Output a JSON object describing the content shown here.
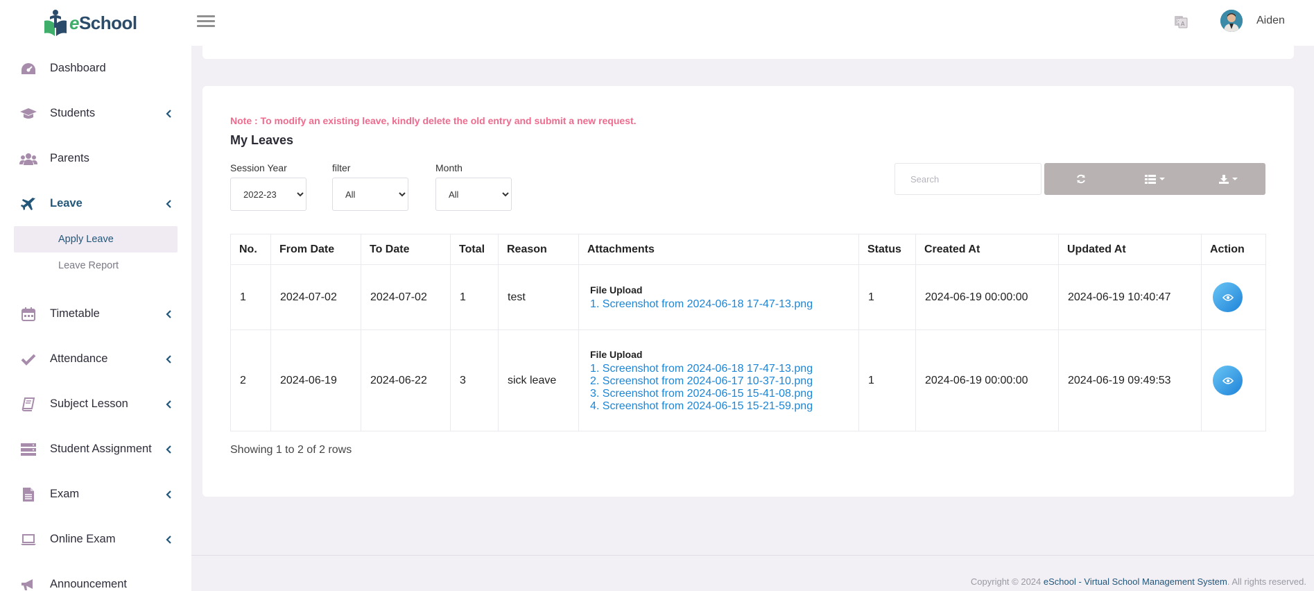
{
  "brand": {
    "name_prefix": "e",
    "name_rest": "School"
  },
  "sidebar": {
    "items": [
      {
        "label": "Dashboard",
        "icon": "dashboard-icon"
      },
      {
        "label": "Students",
        "icon": "graduation-cap-icon"
      },
      {
        "label": "Parents",
        "icon": "users-icon"
      },
      {
        "label": "Leave",
        "icon": "plane-icon"
      },
      {
        "label": "Timetable",
        "icon": "calendar-icon"
      },
      {
        "label": "Attendance",
        "icon": "check-icon"
      },
      {
        "label": "Subject Lesson",
        "icon": "book-icon"
      },
      {
        "label": "Student Assignment",
        "icon": "server-icon"
      },
      {
        "label": "Exam",
        "icon": "file-icon"
      },
      {
        "label": "Online Exam",
        "icon": "laptop-icon"
      },
      {
        "label": "Announcement",
        "icon": "bullhorn-icon"
      }
    ],
    "leave_sub": [
      {
        "label": "Apply Leave"
      },
      {
        "label": "Leave Report"
      }
    ]
  },
  "topbar": {
    "username": "Aiden"
  },
  "card": {
    "note": "Note : To modify an existing leave, kindly delete the old entry and submit a new request.",
    "title": "My Leaves",
    "filters": {
      "session_label": "Session Year",
      "session_value": "2022-23",
      "filter_label": "filter",
      "filter_value": "All",
      "month_label": "Month",
      "month_value": "All"
    },
    "search_placeholder": "Search"
  },
  "table": {
    "headers": [
      "No.",
      "From Date",
      "To Date",
      "Total",
      "Reason",
      "Attachments",
      "Status",
      "Created At",
      "Updated At",
      "Action"
    ],
    "rows": [
      {
        "no": "1",
        "from": "2024-07-02",
        "to": "2024-07-02",
        "total": "1",
        "reason": "test",
        "att_title": "File Upload",
        "attachments": [
          "1. Screenshot from 2024-06-18 17-47-13.png"
        ],
        "status": "1",
        "created": "2024-06-19 00:00:00",
        "updated": "2024-06-19 10:40:47"
      },
      {
        "no": "2",
        "from": "2024-06-19",
        "to": "2024-06-22",
        "total": "3",
        "reason": "sick leave",
        "att_title": "File Upload",
        "attachments": [
          "1. Screenshot from 2024-06-18 17-47-13.png",
          "2. Screenshot from 2024-06-17 10-37-10.png",
          "3. Screenshot from 2024-06-15 15-41-08.png",
          "4. Screenshot from 2024-06-15 15-21-59.png"
        ],
        "status": "1",
        "created": "2024-06-19 00:00:00",
        "updated": "2024-06-19 09:49:53"
      }
    ],
    "showing": "Showing 1 to 2 of 2 rows"
  },
  "footer": {
    "prefix": "Copyright © 2024 ",
    "link": "eSchool - Virtual School Management System",
    "suffix": ". All rights reserved."
  },
  "colors": {
    "accent": "#22577a",
    "note": "#ee6b8e",
    "link": "#1a86d8",
    "toolbar": "#b8b2b2",
    "sidebar_icon": "#a78dab",
    "background": "#f2eff5"
  }
}
